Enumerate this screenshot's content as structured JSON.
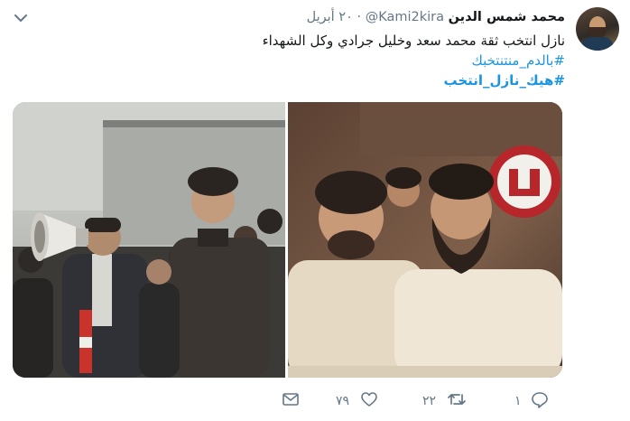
{
  "tweet": {
    "author_name": "محمد شمس الدين",
    "handle": "@Kami2kira",
    "separator": "·",
    "time": "٢٠ أبريل",
    "text_line_1": "نازل انتخب ثقة محمد سعد وخليل جرادي وكل الشهداء",
    "hashtag_1": "#بالدم_منتنتخبك",
    "hashtag_2": "#هيك_نازل_انتخب"
  },
  "actions": {
    "reply_count": "١",
    "retweet_count": "٢٢",
    "like_count": "٧٩"
  },
  "icons": {
    "caret": "chevron-down-icon",
    "reply": "reply-icon",
    "retweet": "retweet-icon",
    "like": "heart-icon",
    "message": "envelope-icon"
  },
  "colors": {
    "link": "#1b95e0",
    "muted": "#657786",
    "text": "#14171a"
  }
}
